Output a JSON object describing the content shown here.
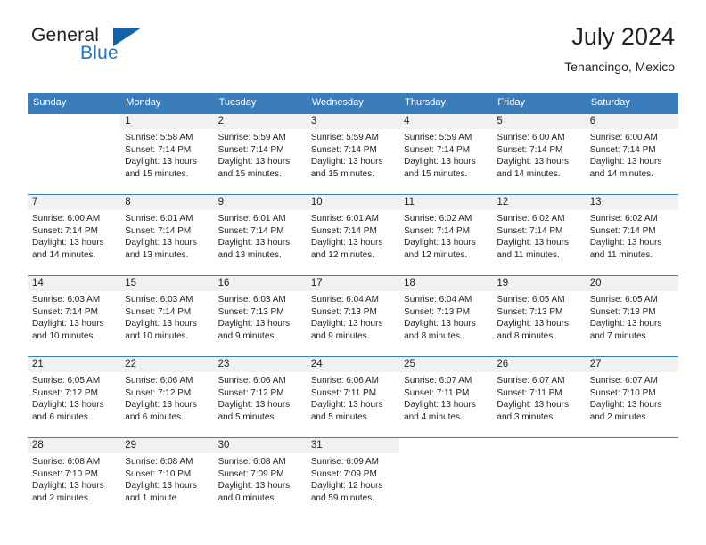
{
  "brand": {
    "name_top": "General",
    "name_bottom": "Blue",
    "mark": "triangle-logo",
    "accent_color": "#1463a8",
    "blue_text_color": "#2175bd"
  },
  "header": {
    "title": "July 2024",
    "subtitle": "Tenancingo, Mexico"
  },
  "theme": {
    "header_row_background": "#3b7cba",
    "header_row_text": "#ffffff",
    "daynum_band_background": "#f1f1f1",
    "week_separator": "#3b7cba",
    "body_text": "#231f20"
  },
  "weekday_headers": [
    "Sunday",
    "Monday",
    "Tuesday",
    "Wednesday",
    "Thursday",
    "Friday",
    "Saturday"
  ],
  "weeks": [
    [
      {
        "day": "",
        "sunrise": "",
        "sunset": "",
        "daylight1": "",
        "daylight2": ""
      },
      {
        "day": "1",
        "sunrise": "Sunrise: 5:58 AM",
        "sunset": "Sunset: 7:14 PM",
        "daylight1": "Daylight: 13 hours",
        "daylight2": "and 15 minutes."
      },
      {
        "day": "2",
        "sunrise": "Sunrise: 5:59 AM",
        "sunset": "Sunset: 7:14 PM",
        "daylight1": "Daylight: 13 hours",
        "daylight2": "and 15 minutes."
      },
      {
        "day": "3",
        "sunrise": "Sunrise: 5:59 AM",
        "sunset": "Sunset: 7:14 PM",
        "daylight1": "Daylight: 13 hours",
        "daylight2": "and 15 minutes."
      },
      {
        "day": "4",
        "sunrise": "Sunrise: 5:59 AM",
        "sunset": "Sunset: 7:14 PM",
        "daylight1": "Daylight: 13 hours",
        "daylight2": "and 15 minutes."
      },
      {
        "day": "5",
        "sunrise": "Sunrise: 6:00 AM",
        "sunset": "Sunset: 7:14 PM",
        "daylight1": "Daylight: 13 hours",
        "daylight2": "and 14 minutes."
      },
      {
        "day": "6",
        "sunrise": "Sunrise: 6:00 AM",
        "sunset": "Sunset: 7:14 PM",
        "daylight1": "Daylight: 13 hours",
        "daylight2": "and 14 minutes."
      }
    ],
    [
      {
        "day": "7",
        "sunrise": "Sunrise: 6:00 AM",
        "sunset": "Sunset: 7:14 PM",
        "daylight1": "Daylight: 13 hours",
        "daylight2": "and 14 minutes."
      },
      {
        "day": "8",
        "sunrise": "Sunrise: 6:01 AM",
        "sunset": "Sunset: 7:14 PM",
        "daylight1": "Daylight: 13 hours",
        "daylight2": "and 13 minutes."
      },
      {
        "day": "9",
        "sunrise": "Sunrise: 6:01 AM",
        "sunset": "Sunset: 7:14 PM",
        "daylight1": "Daylight: 13 hours",
        "daylight2": "and 13 minutes."
      },
      {
        "day": "10",
        "sunrise": "Sunrise: 6:01 AM",
        "sunset": "Sunset: 7:14 PM",
        "daylight1": "Daylight: 13 hours",
        "daylight2": "and 12 minutes."
      },
      {
        "day": "11",
        "sunrise": "Sunrise: 6:02 AM",
        "sunset": "Sunset: 7:14 PM",
        "daylight1": "Daylight: 13 hours",
        "daylight2": "and 12 minutes."
      },
      {
        "day": "12",
        "sunrise": "Sunrise: 6:02 AM",
        "sunset": "Sunset: 7:14 PM",
        "daylight1": "Daylight: 13 hours",
        "daylight2": "and 11 minutes."
      },
      {
        "day": "13",
        "sunrise": "Sunrise: 6:02 AM",
        "sunset": "Sunset: 7:14 PM",
        "daylight1": "Daylight: 13 hours",
        "daylight2": "and 11 minutes."
      }
    ],
    [
      {
        "day": "14",
        "sunrise": "Sunrise: 6:03 AM",
        "sunset": "Sunset: 7:14 PM",
        "daylight1": "Daylight: 13 hours",
        "daylight2": "and 10 minutes."
      },
      {
        "day": "15",
        "sunrise": "Sunrise: 6:03 AM",
        "sunset": "Sunset: 7:14 PM",
        "daylight1": "Daylight: 13 hours",
        "daylight2": "and 10 minutes."
      },
      {
        "day": "16",
        "sunrise": "Sunrise: 6:03 AM",
        "sunset": "Sunset: 7:13 PM",
        "daylight1": "Daylight: 13 hours",
        "daylight2": "and 9 minutes."
      },
      {
        "day": "17",
        "sunrise": "Sunrise: 6:04 AM",
        "sunset": "Sunset: 7:13 PM",
        "daylight1": "Daylight: 13 hours",
        "daylight2": "and 9 minutes."
      },
      {
        "day": "18",
        "sunrise": "Sunrise: 6:04 AM",
        "sunset": "Sunset: 7:13 PM",
        "daylight1": "Daylight: 13 hours",
        "daylight2": "and 8 minutes."
      },
      {
        "day": "19",
        "sunrise": "Sunrise: 6:05 AM",
        "sunset": "Sunset: 7:13 PM",
        "daylight1": "Daylight: 13 hours",
        "daylight2": "and 8 minutes."
      },
      {
        "day": "20",
        "sunrise": "Sunrise: 6:05 AM",
        "sunset": "Sunset: 7:13 PM",
        "daylight1": "Daylight: 13 hours",
        "daylight2": "and 7 minutes."
      }
    ],
    [
      {
        "day": "21",
        "sunrise": "Sunrise: 6:05 AM",
        "sunset": "Sunset: 7:12 PM",
        "daylight1": "Daylight: 13 hours",
        "daylight2": "and 6 minutes."
      },
      {
        "day": "22",
        "sunrise": "Sunrise: 6:06 AM",
        "sunset": "Sunset: 7:12 PM",
        "daylight1": "Daylight: 13 hours",
        "daylight2": "and 6 minutes."
      },
      {
        "day": "23",
        "sunrise": "Sunrise: 6:06 AM",
        "sunset": "Sunset: 7:12 PM",
        "daylight1": "Daylight: 13 hours",
        "daylight2": "and 5 minutes."
      },
      {
        "day": "24",
        "sunrise": "Sunrise: 6:06 AM",
        "sunset": "Sunset: 7:11 PM",
        "daylight1": "Daylight: 13 hours",
        "daylight2": "and 5 minutes."
      },
      {
        "day": "25",
        "sunrise": "Sunrise: 6:07 AM",
        "sunset": "Sunset: 7:11 PM",
        "daylight1": "Daylight: 13 hours",
        "daylight2": "and 4 minutes."
      },
      {
        "day": "26",
        "sunrise": "Sunrise: 6:07 AM",
        "sunset": "Sunset: 7:11 PM",
        "daylight1": "Daylight: 13 hours",
        "daylight2": "and 3 minutes."
      },
      {
        "day": "27",
        "sunrise": "Sunrise: 6:07 AM",
        "sunset": "Sunset: 7:10 PM",
        "daylight1": "Daylight: 13 hours",
        "daylight2": "and 2 minutes."
      }
    ],
    [
      {
        "day": "28",
        "sunrise": "Sunrise: 6:08 AM",
        "sunset": "Sunset: 7:10 PM",
        "daylight1": "Daylight: 13 hours",
        "daylight2": "and 2 minutes."
      },
      {
        "day": "29",
        "sunrise": "Sunrise: 6:08 AM",
        "sunset": "Sunset: 7:10 PM",
        "daylight1": "Daylight: 13 hours",
        "daylight2": "and 1 minute."
      },
      {
        "day": "30",
        "sunrise": "Sunrise: 6:08 AM",
        "sunset": "Sunset: 7:09 PM",
        "daylight1": "Daylight: 13 hours",
        "daylight2": "and 0 minutes."
      },
      {
        "day": "31",
        "sunrise": "Sunrise: 6:09 AM",
        "sunset": "Sunset: 7:09 PM",
        "daylight1": "Daylight: 12 hours",
        "daylight2": "and 59 minutes."
      },
      {
        "day": "",
        "sunrise": "",
        "sunset": "",
        "daylight1": "",
        "daylight2": ""
      },
      {
        "day": "",
        "sunrise": "",
        "sunset": "",
        "daylight1": "",
        "daylight2": ""
      },
      {
        "day": "",
        "sunrise": "",
        "sunset": "",
        "daylight1": "",
        "daylight2": ""
      }
    ]
  ]
}
